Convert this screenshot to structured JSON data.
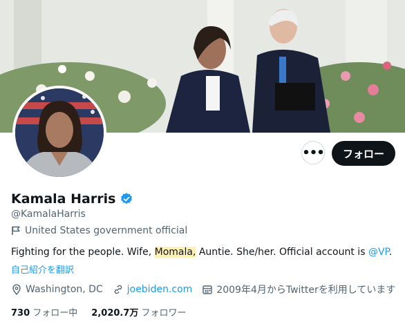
{
  "profile": {
    "display_name": "Kamala Harris",
    "handle": "@KamalaHarris",
    "verified_icon": "verified-badge-icon",
    "label": "United States government official",
    "bio_pre": "Fighting for the people. Wife, ",
    "bio_highlight": "Momala,",
    "bio_mid": " Auntie. She/her. Official account is ",
    "bio_mention": "@VP",
    "bio_end": ".",
    "translate_link": "自己紹介を翻訳",
    "location": "Washington, DC",
    "website": "joebiden.com",
    "joined": "2009年4月からTwitterを利用しています"
  },
  "actions": {
    "more_label": "•••",
    "follow_label": "フォロー"
  },
  "stats": {
    "following_count": "730",
    "following_label": "フォロー中",
    "followers_count": "2,020.7万",
    "followers_label": "フォロワー"
  },
  "colors": {
    "accent": "#1d9bf0",
    "text": "#0f1419",
    "muted": "#536471",
    "highlight": "#fff0b3"
  }
}
